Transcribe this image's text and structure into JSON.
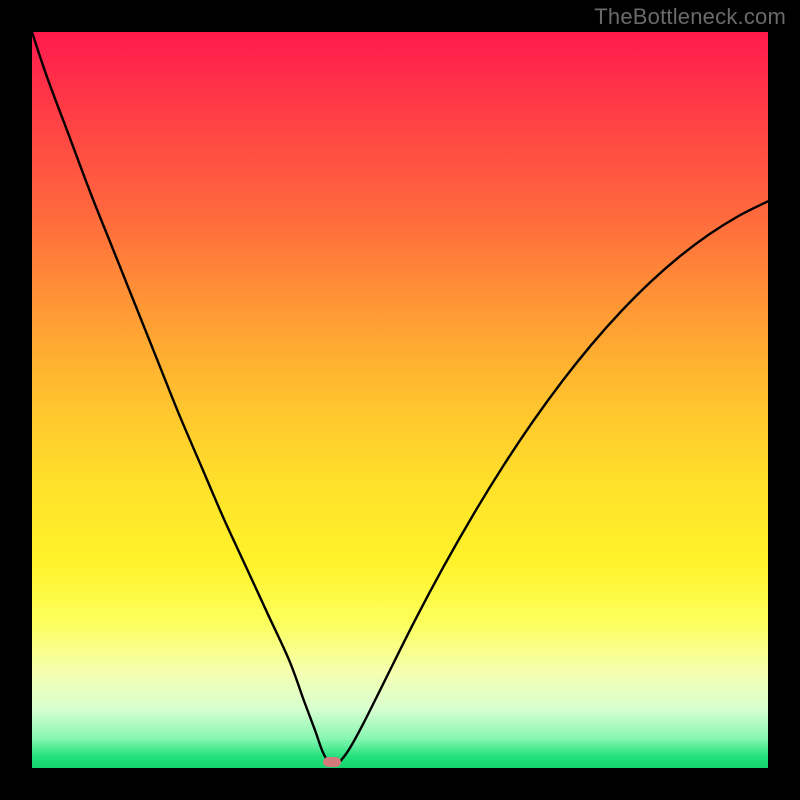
{
  "watermark": "TheBottleneck.com",
  "chart_data": {
    "type": "line",
    "title": "",
    "xlabel": "",
    "ylabel": "",
    "xlim": [
      0,
      100
    ],
    "ylim": [
      0,
      100
    ],
    "grid": false,
    "legend": false,
    "series": [
      {
        "name": "bottleneck-curve",
        "x": [
          0,
          2,
          5,
          8,
          11,
          14,
          17,
          20,
          23,
          26,
          29,
          32,
          35,
          37,
          38.5,
          39.5,
          40.5,
          41.5,
          43,
          45,
          48,
          52,
          56,
          60,
          64,
          68,
          72,
          76,
          80,
          84,
          88,
          92,
          96,
          100
        ],
        "y": [
          100,
          94,
          86,
          78,
          70.5,
          63,
          55.5,
          48,
          41,
          34,
          27.5,
          21,
          14.5,
          9,
          5,
          2.2,
          0.6,
          0.6,
          2.4,
          6,
          12,
          20,
          27.5,
          34.5,
          41,
          47,
          52.5,
          57.5,
          62,
          66,
          69.5,
          72.5,
          75,
          77
        ]
      }
    ],
    "marker": {
      "x_pct": 40.8,
      "y_pct_from_top": 99.2
    },
    "background_gradient": {
      "stops": [
        {
          "pct": 0,
          "color": "#ff1a4d"
        },
        {
          "pct": 25,
          "color": "#ff6a3d"
        },
        {
          "pct": 50,
          "color": "#ffc22e"
        },
        {
          "pct": 75,
          "color": "#fff22a"
        },
        {
          "pct": 92,
          "color": "#d8ffd0"
        },
        {
          "pct": 100,
          "color": "#14d46f"
        }
      ]
    }
  }
}
